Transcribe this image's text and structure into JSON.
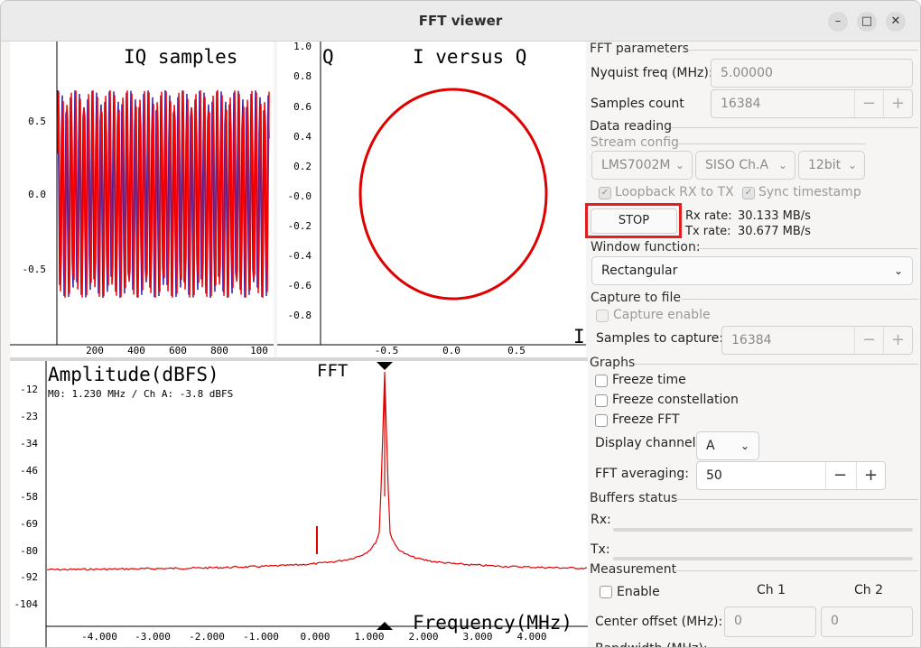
{
  "window": {
    "title": "FFT viewer",
    "minimize_icon": "minimize-icon",
    "maximize_icon": "maximize-icon",
    "close_icon": "close-icon"
  },
  "iq_plot": {
    "title": "IQ samples",
    "y_ticks": [
      "0.5",
      "0.0",
      "-0.5"
    ],
    "x_ticks": [
      "200",
      "400",
      "600",
      "800",
      "100"
    ]
  },
  "const_plot": {
    "title": "I versus Q",
    "y_label": "Q",
    "x_label": "I",
    "y_ticks": [
      "1.0",
      "0.8",
      "0.6",
      "0.4",
      "0.2",
      "-0.0",
      "-0.2",
      "-0.4",
      "-0.6",
      "-0.8"
    ],
    "x_ticks": [
      "-0.5",
      "0.0",
      "0.5"
    ]
  },
  "fft_plot": {
    "ylabel": "Amplitude(dBFS)",
    "title": "FFT",
    "marker_text": "M0:  1.230 MHz / Ch A: -3.8 dBFS",
    "xlabel": "Frequency(MHz)",
    "y_ticks": [
      "-12",
      "-23",
      "-34",
      "-46",
      "-58",
      "-69",
      "-80",
      "-92",
      "-104"
    ],
    "x_ticks": [
      "-4.000",
      "-3.000",
      "-2.000",
      "-1.000",
      "0.000",
      "1.000",
      "2.000",
      "3.000",
      "4.000"
    ]
  },
  "fft_params": {
    "group": "FFT parameters",
    "nyquist_label": "Nyquist freq (MHz):",
    "nyquist_value": "5.00000",
    "samples_label": "Samples count",
    "samples_value": "16384",
    "minus": "−",
    "plus": "+"
  },
  "data_reading": {
    "group": "Data reading",
    "stream_group": "Stream config",
    "device": "LMS7002M",
    "channel": "SISO Ch.A",
    "format": "12bit",
    "loopback_label": "Loopback RX to TX",
    "sync_label": "Sync timestamp",
    "stop_label": "STOP",
    "rx_rate_label": "Rx rate:",
    "rx_rate_value": "30.133 MB/s",
    "tx_rate_label": "Tx rate:",
    "tx_rate_value": "30.677 MB/s"
  },
  "window_function": {
    "group": "Window function:",
    "value": "Rectangular"
  },
  "capture": {
    "group": "Capture to file",
    "enable_label": "Capture enable",
    "samples_label": "Samples to capture:",
    "samples_value": "16384"
  },
  "graphs": {
    "group": "Graphs",
    "freeze_time": "Freeze time",
    "freeze_constellation": "Freeze constellation",
    "freeze_fft": "Freeze FFT",
    "display_channel_label": "Display channel:",
    "display_channel_value": "A",
    "fft_averaging_label": "FFT averaging:",
    "fft_averaging_value": "50"
  },
  "buffers": {
    "group": "Buffers status",
    "rx_label": "Rx:",
    "tx_label": "Tx:"
  },
  "measurement": {
    "group": "Measurement",
    "enable_label": "Enable",
    "ch1": "Ch 1",
    "ch2": "Ch 2",
    "center_offset_label": "Center offset (MHz):",
    "ch1_value": "0",
    "ch2_value": "0",
    "bandwidth_label": "Bandwidth (MHz):"
  },
  "colors": {
    "trace_red": "#ff0000",
    "trace_blue": "#3b1fa0",
    "highlight": "#e02020"
  }
}
